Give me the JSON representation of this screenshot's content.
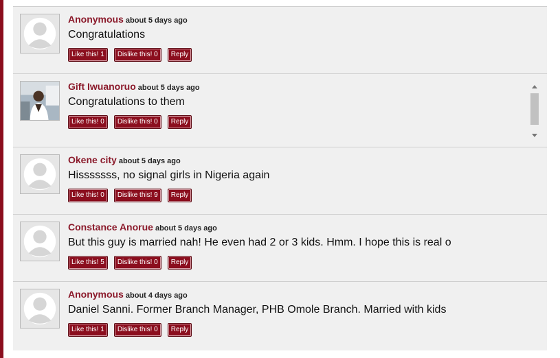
{
  "comments": [
    {
      "author": "Anonymous",
      "time": "about 5 days ago",
      "text": "Congratulations",
      "like": "Like this! 1",
      "dislike": "Dislike this! 0",
      "reply": "Reply",
      "avatar": "default"
    },
    {
      "author": "Gift Iwuanoruo",
      "time": "about 5 days ago",
      "text": "Congratulations to them",
      "like": "Like this! 0",
      "dislike": "Dislike this! 0",
      "reply": "Reply",
      "avatar": "photo"
    },
    {
      "author": "Okene city",
      "time": "about 5 days ago",
      "text": "Hisssssss, no signal girls in Nigeria again",
      "like": "Like this! 0",
      "dislike": "Dislike this! 9",
      "reply": "Reply",
      "avatar": "default"
    },
    {
      "author": "Constance Anorue",
      "time": "about 5 days ago",
      "text": "But this guy is married nah! He even had 2 or 3 kids. Hmm. I hope this is real o",
      "like": "Like this! 5",
      "dislike": "Dislike this! 0",
      "reply": "Reply",
      "avatar": "default"
    },
    {
      "author": "Anonymous",
      "time": "about 4 days ago",
      "text": "Daniel Sanni. Former Branch Manager, PHB Omole Branch. Married with kids",
      "like": "Like this! 1",
      "dislike": "Dislike this! 0",
      "reply": "Reply",
      "avatar": "default"
    }
  ],
  "colors": {
    "accent": "#8b0e1e",
    "author": "#8b1a2b",
    "background": "#f0f0f0"
  }
}
